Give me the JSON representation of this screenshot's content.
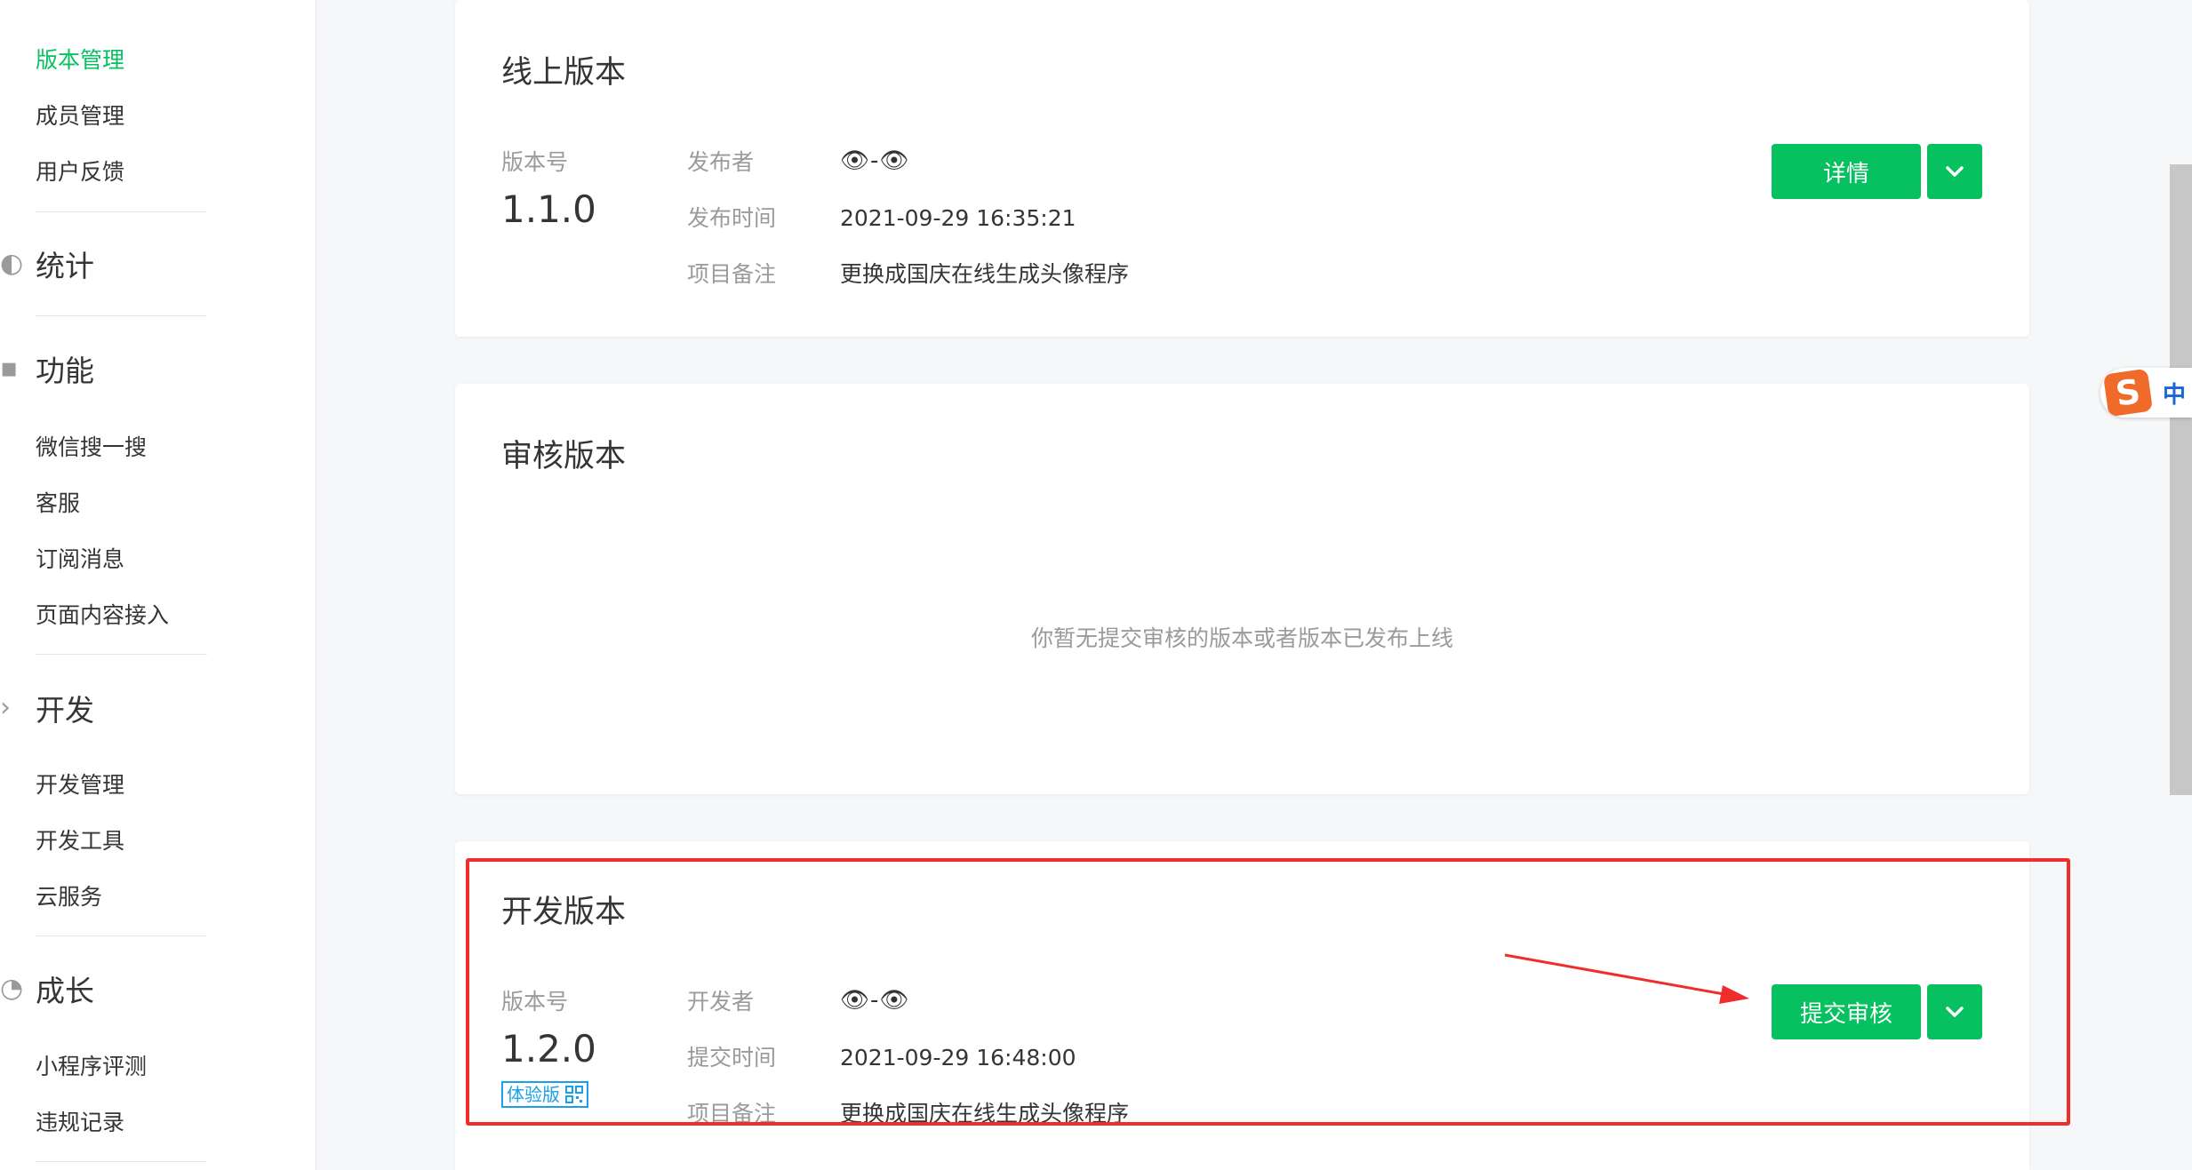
{
  "sidebar": {
    "items_top": [
      "版本管理",
      "成员管理",
      "用户反馈"
    ],
    "sections": [
      {
        "title": "统计",
        "items": []
      },
      {
        "title": "功能",
        "items": [
          "微信搜一搜",
          "客服",
          "订阅消息",
          "页面内容接入"
        ]
      },
      {
        "title": "开发",
        "items": [
          "开发管理",
          "开发工具",
          "云服务"
        ]
      },
      {
        "title": "成长",
        "items": [
          "小程序评测",
          "违规记录"
        ]
      }
    ],
    "active_item": "版本管理"
  },
  "online": {
    "title": "线上版本",
    "version_label": "版本号",
    "version": "1.1.0",
    "publisher_label": "发布者",
    "publisher": "👁-👁",
    "time_label": "发布时间",
    "time": "2021-09-29 16:35:21",
    "note_label": "项目备注",
    "note": "更换成国庆在线生成头像程序",
    "detail_button": "详情"
  },
  "review": {
    "title": "审核版本",
    "empty_text": "你暂无提交审核的版本或者版本已发布上线"
  },
  "dev": {
    "title": "开发版本",
    "version_label": "版本号",
    "version": "1.2.0",
    "badge": "体验版",
    "developer_label": "开发者",
    "developer": "👁-👁",
    "time_label": "提交时间",
    "time": "2021-09-29 16:48:00",
    "note_label": "项目备注",
    "note": "更换成国庆在线生成头像程序",
    "submit_button": "提交审核"
  },
  "ime": {
    "logo": "S",
    "mode": "中"
  },
  "colors": {
    "accent": "#07c160",
    "highlight": "#f02d2d",
    "badge": "#1aa0e6"
  }
}
